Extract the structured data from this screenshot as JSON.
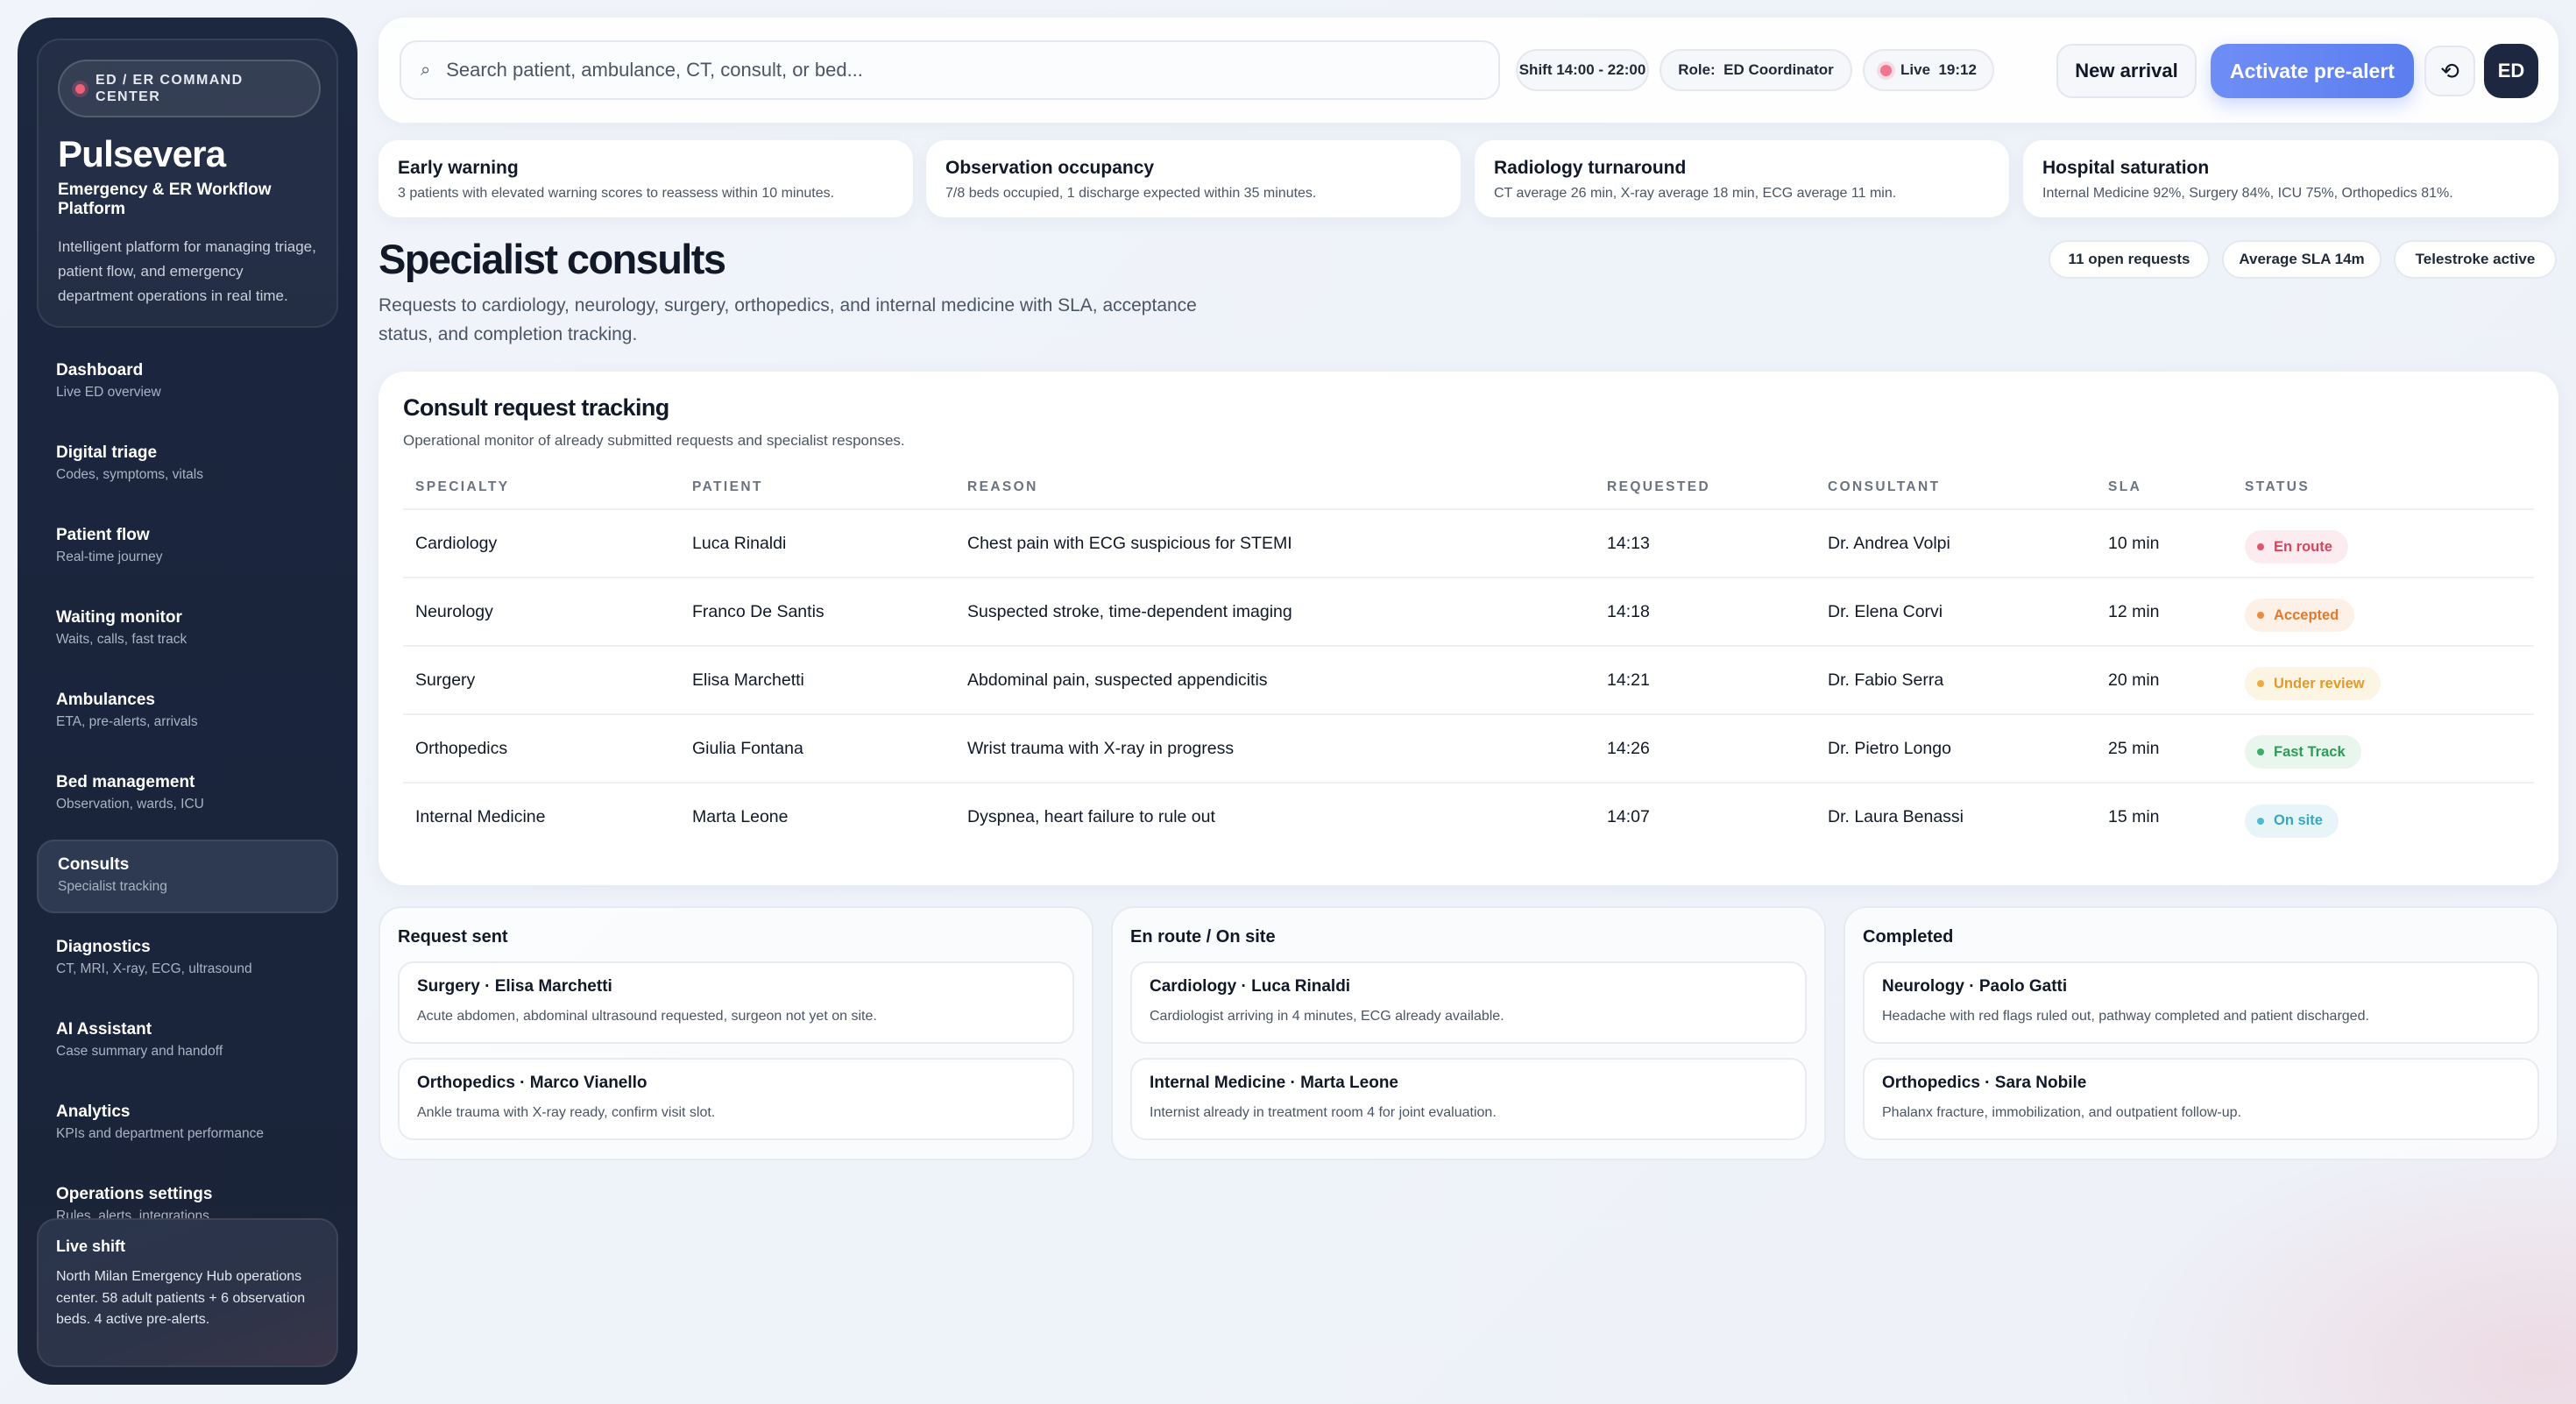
{
  "brand": {
    "badge": "ED / ER COMMAND CENTER",
    "name": "Pulsevera",
    "subtitle": "Emergency & ER Workflow Platform",
    "description": "Intelligent platform for managing triage, patient flow, and emergency department operations in real time."
  },
  "nav": [
    {
      "label": "Dashboard",
      "sub": "Live ED overview"
    },
    {
      "label": "Digital triage",
      "sub": "Codes, symptoms, vitals"
    },
    {
      "label": "Patient flow",
      "sub": "Real-time journey"
    },
    {
      "label": "Waiting monitor",
      "sub": "Waits, calls, fast track"
    },
    {
      "label": "Ambulances",
      "sub": "ETA, pre-alerts, arrivals"
    },
    {
      "label": "Bed management",
      "sub": "Observation, wards, ICU"
    },
    {
      "label": "Consults",
      "sub": "Specialist tracking"
    },
    {
      "label": "Diagnostics",
      "sub": "CT, MRI, X-ray, ECG, ultrasound"
    },
    {
      "label": "AI Assistant",
      "sub": "Case summary and handoff"
    },
    {
      "label": "Analytics",
      "sub": "KPIs and department performance"
    },
    {
      "label": "Operations settings",
      "sub": "Rules, alerts, integrations"
    }
  ],
  "live_shift": {
    "title": "Live shift",
    "text": "North Milan Emergency Hub operations center. 58 adult patients + 6 observation beds. 4 active pre-alerts."
  },
  "topbar": {
    "search_placeholder": "Search patient, ambulance, CT, consult, or bed...",
    "shift": "Shift 14:00 - 22:00",
    "role": "Role:  ED Coordinator",
    "live": "Live  19:12",
    "new_arrival": "New arrival",
    "activate_prealert": "Activate pre-alert",
    "avatar": "ED"
  },
  "stats": [
    {
      "title": "Early warning",
      "text": "3 patients with elevated warning scores to reassess within 10 minutes."
    },
    {
      "title": "Observation occupancy",
      "text": "7/8 beds occupied, 1 discharge expected within 35 minutes."
    },
    {
      "title": "Radiology turnaround",
      "text": "CT average 26 min, X-ray average 18 min, ECG average 11 min."
    },
    {
      "title": "Hospital saturation",
      "text": "Internal Medicine 92%, Surgery 84%, ICU 75%, Orthopedics 81%."
    }
  ],
  "page": {
    "title": "Specialist consults",
    "description": "Requests to cardiology, neurology, surgery, orthopedics, and internal medicine with SLA, acceptance status, and completion tracking.",
    "pills": [
      "11 open requests",
      "Average SLA 14m",
      "Telestroke active"
    ]
  },
  "table": {
    "title": "Consult request tracking",
    "subtitle": "Operational monitor of already submitted requests and specialist responses.",
    "headers": [
      "SPECIALTY",
      "PATIENT",
      "REASON",
      "REQUESTED",
      "CONSULTANT",
      "SLA",
      "STATUS"
    ],
    "rows": [
      {
        "specialty": "Cardiology",
        "patient": "Luca Rinaldi",
        "reason": "Chest pain with ECG suspicious for STEMI",
        "requested": "14:13",
        "consultant": "Dr. Andrea Volpi",
        "sla": "10 min",
        "status": "En route"
      },
      {
        "specialty": "Neurology",
        "patient": "Franco De Santis",
        "reason": "Suspected stroke, time-dependent imaging",
        "requested": "14:18",
        "consultant": "Dr. Elena Corvi",
        "sla": "12 min",
        "status": "Accepted"
      },
      {
        "specialty": "Surgery",
        "patient": "Elisa Marchetti",
        "reason": "Abdominal pain, suspected appendicitis",
        "requested": "14:21",
        "consultant": "Dr. Fabio Serra",
        "sla": "20 min",
        "status": "Under review"
      },
      {
        "specialty": "Orthopedics",
        "patient": "Giulia Fontana",
        "reason": "Wrist trauma with X-ray in progress",
        "requested": "14:26",
        "consultant": "Dr. Pietro Longo",
        "sla": "25 min",
        "status": "Fast Track"
      },
      {
        "specialty": "Internal Medicine",
        "patient": "Marta Leone",
        "reason": "Dyspnea, heart failure to rule out",
        "requested": "14:07",
        "consultant": "Dr. Laura Benassi",
        "sla": "15 min",
        "status": "On site"
      }
    ]
  },
  "status_colors": {
    "En route": {
      "bg": "#fdecef",
      "fg": "#d6455f",
      "dot": "#e0566f"
    },
    "Accepted": {
      "bg": "#fdf0e6",
      "fg": "#e07a2e",
      "dot": "#ee8a3a"
    },
    "Under review": {
      "bg": "#fdf5e3",
      "fg": "#e09a2c",
      "dot": "#f0ac3a"
    },
    "Fast Track": {
      "bg": "#e8f6ee",
      "fg": "#2f9a5a",
      "dot": "#3aae68"
    },
    "On site": {
      "bg": "#e7f5f8",
      "fg": "#3aa7bd",
      "dot": "#4bbcd1"
    }
  },
  "kanban": [
    {
      "title": "Request sent",
      "cards": [
        {
          "title": "Surgery · Elisa Marchetti",
          "text": "Acute abdomen, abdominal ultrasound requested, surgeon not yet on site."
        },
        {
          "title": "Orthopedics · Marco Vianello",
          "text": "Ankle trauma with X-ray ready, confirm visit slot."
        }
      ]
    },
    {
      "title": "En route / On site",
      "cards": [
        {
          "title": "Cardiology · Luca Rinaldi",
          "text": "Cardiologist arriving in 4 minutes, ECG already available."
        },
        {
          "title": "Internal Medicine · Marta Leone",
          "text": "Internist already in treatment room 4 for joint evaluation."
        }
      ]
    },
    {
      "title": "Completed",
      "cards": [
        {
          "title": "Neurology · Paolo Gatti",
          "text": "Headache with red flags ruled out, pathway completed and patient discharged."
        },
        {
          "title": "Orthopedics · Sara Nobile",
          "text": "Phalanx fracture, immobilization, and outpatient follow-up."
        }
      ]
    }
  ],
  "icons": {
    "search": "search-icon",
    "refresh": "refresh-icon",
    "live": "live-dot-icon"
  }
}
